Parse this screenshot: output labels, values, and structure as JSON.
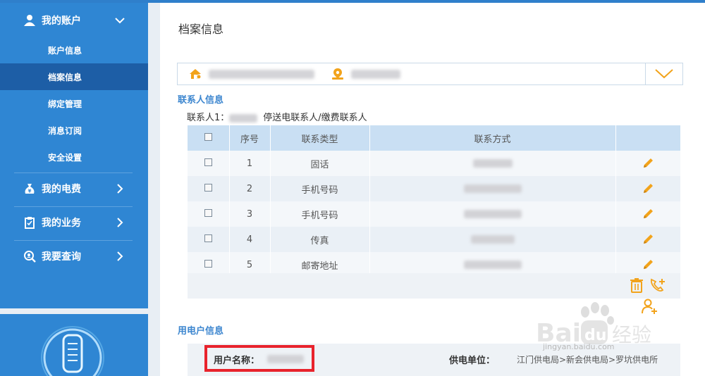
{
  "sidebar": {
    "account_group": {
      "label": "我的账户"
    },
    "sub_items": [
      {
        "label": "账户信息"
      },
      {
        "label": "档案信息"
      },
      {
        "label": "绑定管理"
      },
      {
        "label": "消息订阅"
      },
      {
        "label": "安全设置"
      }
    ],
    "groups": [
      {
        "label": "我的电费",
        "icon": "moneybag-icon"
      },
      {
        "label": "我的业务",
        "icon": "clipboard-icon"
      },
      {
        "label": "我要查询",
        "icon": "search-icon"
      }
    ]
  },
  "main": {
    "page_title": "档案信息",
    "contact_section_title": "联系人信息",
    "contact_prefix": "联系人1：",
    "contact_roles": "停送电联系人/缴费联系人",
    "table": {
      "headers": [
        "",
        "序号",
        "联系类型",
        "联系方式",
        ""
      ],
      "rows": [
        {
          "index": "1",
          "type": "固话"
        },
        {
          "index": "2",
          "type": "手机号码"
        },
        {
          "index": "3",
          "type": "手机号码"
        },
        {
          "index": "4",
          "type": "传真"
        },
        {
          "index": "5",
          "type": "邮寄地址"
        }
      ]
    },
    "user_section_title": "用电户信息",
    "user_name_label": "用户名称：",
    "supply_unit_label": "供电单位：",
    "supply_unit_value": "江门供电局>新会供电局>罗坑供电所"
  },
  "watermark": {
    "text": "jingyan.baidu.com"
  },
  "colors": {
    "sidebar": "#2f86d3",
    "sidebar_active": "#1d5ea6",
    "accent_text": "#3c86cf",
    "icon_orange": "#f2a31b",
    "highlight_red": "#e8232c"
  }
}
